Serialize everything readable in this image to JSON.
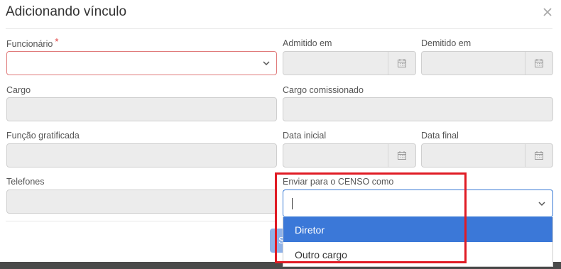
{
  "modal": {
    "title": "Adicionando vínculo",
    "close_icon": "close-icon"
  },
  "fields": {
    "funcionario": {
      "label": "Funcionário",
      "required_mark": "*",
      "value": ""
    },
    "admitido_em": {
      "label": "Admitido em",
      "value": "",
      "icon": "calendar-icon"
    },
    "demitido_em": {
      "label": "Demitido em",
      "value": "",
      "icon": "calendar-icon"
    },
    "cargo": {
      "label": "Cargo",
      "value": ""
    },
    "cargo_comissionado": {
      "label": "Cargo comissionado",
      "value": ""
    },
    "funcao_gratificada": {
      "label": "Função gratificada",
      "value": ""
    },
    "data_inicial": {
      "label": "Data inicial",
      "value": "",
      "icon": "calendar-icon"
    },
    "data_final": {
      "label": "Data final",
      "value": "",
      "icon": "calendar-icon"
    },
    "telefones": {
      "label": "Telefones",
      "value": ""
    },
    "enviar_censo": {
      "label": "Enviar para o CENSO como",
      "value": "",
      "options": [
        "Diretor",
        "Outro cargo"
      ],
      "highlighted_option": "Diretor"
    }
  },
  "footer": {
    "partial_button_label": "S"
  },
  "colors": {
    "accent": "#3b78d8",
    "required": "#e03a3a",
    "annotation_box": "#e01b24",
    "disabled_bg": "#ececec"
  }
}
